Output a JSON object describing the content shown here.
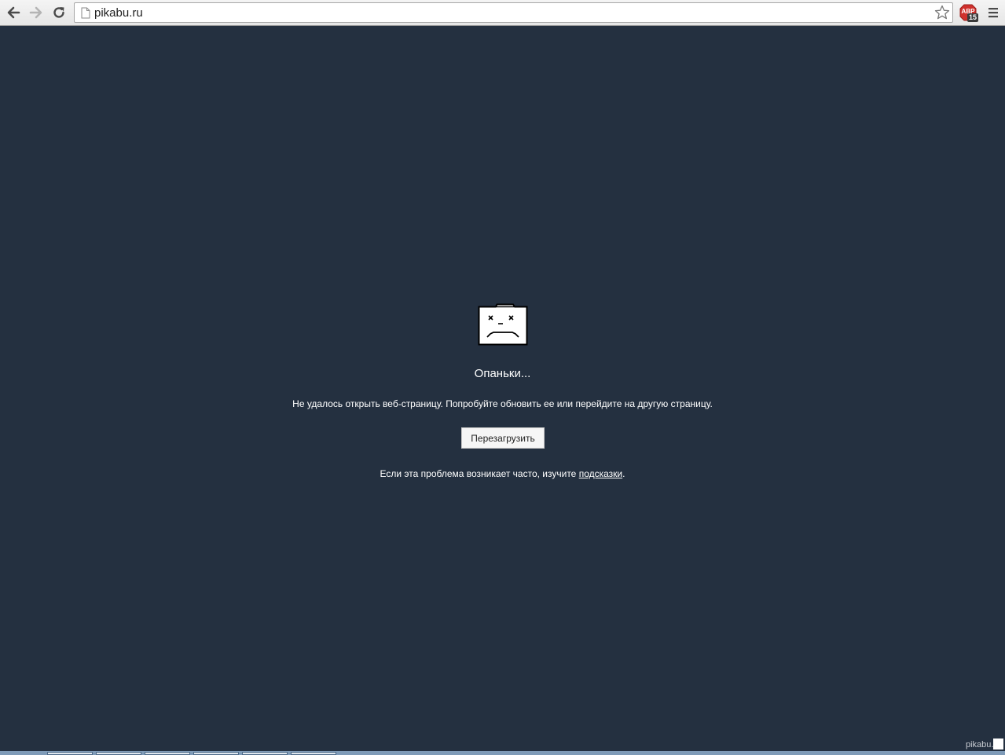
{
  "browser": {
    "url": "pikabu.ru",
    "back_icon": "back-arrow-icon",
    "forward_icon": "forward-arrow-icon",
    "reload_icon": "reload-icon",
    "bookmark_icon": "star-icon",
    "extension": {
      "label": "ABP",
      "badge": "15"
    },
    "menu_icon": "hamburger-menu-icon"
  },
  "error_page": {
    "icon": "sad-tab-icon",
    "title": "Опаньки...",
    "message": "Не удалось открыть веб-страницу. Попробуйте обновить ее или перейдите на другую страницу.",
    "reload_label": "Перезагрузить",
    "help_prefix": "Если эта проблема возникает часто, изучите ",
    "help_link": "подсказки",
    "help_suffix": "."
  },
  "watermark": "pikabu.ru",
  "colors": {
    "background": "#243040",
    "text": "#ffffff",
    "abp_red": "#d0312d"
  }
}
